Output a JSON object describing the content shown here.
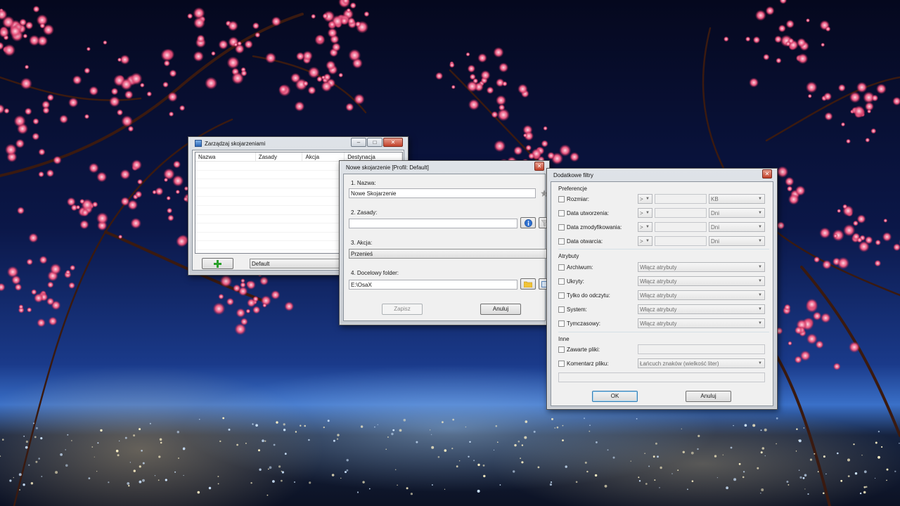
{
  "manage_window": {
    "title": "Zarządzaj skojarzeniami",
    "columns": [
      "Nazwa",
      "Zasady",
      "Akcja",
      "Destynacja"
    ],
    "profile_value": "Default"
  },
  "new_window": {
    "title": "Nowe skojarzenie [Profil: Default]",
    "name_label": "1. Nazwa:",
    "name_value": "Nowe Skojarzenie",
    "rules_label": "2. Zasady:",
    "rules_value": "",
    "action_label": "3. Akcja:",
    "action_value": "Przenieś",
    "folder_label": "4. Docelowy folder:",
    "folder_value": "E:\\OsaX",
    "save_label": "Zapisz",
    "cancel_label": "Anuluj"
  },
  "filters_window": {
    "title": "Dodatkowe filtry",
    "preferences_group": "Preferencje",
    "preferences": [
      {
        "label": "Rozmiar:",
        "op": ">",
        "value": "",
        "unit": "KB"
      },
      {
        "label": "Data utworzenia:",
        "op": ">",
        "value": "",
        "unit": "Dni"
      },
      {
        "label": "Data zmodyfikowania:",
        "op": ">",
        "value": "",
        "unit": "Dni"
      },
      {
        "label": "Data otwarcia:",
        "op": ">",
        "value": "",
        "unit": "Dni"
      }
    ],
    "attributes_group": "Atrybuty",
    "attributes": [
      {
        "label": "Archiwum:",
        "value": "Włącz atrybuty"
      },
      {
        "label": "Ukryty:",
        "value": "Włącz atrybuty"
      },
      {
        "label": "Tylko do odczytu:",
        "value": "Włącz atrybuty"
      },
      {
        "label": "System:",
        "value": "Włącz atrybuty"
      },
      {
        "label": "Tymczasowy:",
        "value": "Włącz atrybuty"
      }
    ],
    "other_group": "Inne",
    "contains_label": "Zawarte pliki:",
    "comment_label": "Komentarz pliku:",
    "comment_mode": "Łańcuch znaków (wielkość liter)",
    "ok_label": "OK",
    "cancel_label": "Anuluj"
  },
  "window_controls": {
    "minimize": "–",
    "maximize": "□",
    "close": "✕"
  }
}
